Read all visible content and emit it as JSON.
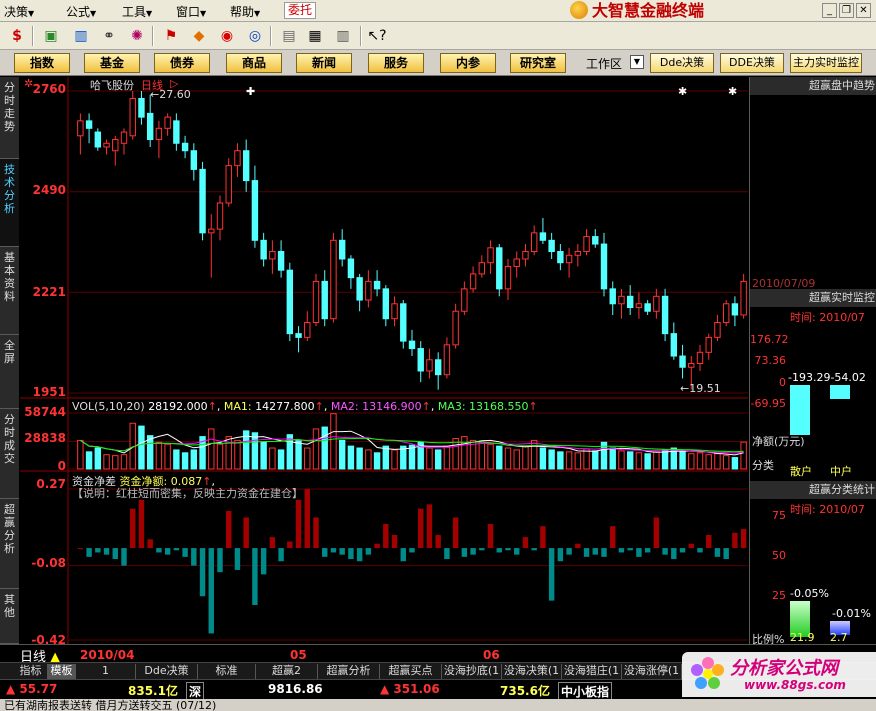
{
  "menu": {
    "items": [
      "决策",
      "公式",
      "工具",
      "窗口",
      "帮助"
    ],
    "entrust": "委托"
  },
  "brand": {
    "title": "大智慧金融终端"
  },
  "funcbar": {
    "buttons": [
      "指数",
      "基金",
      "债券",
      "商品",
      "新闻",
      "服务",
      "内参",
      "研究室"
    ],
    "workarea": "工作区",
    "dde_buttons": [
      "Dde决策",
      "DDE决策",
      "主力实时监控"
    ]
  },
  "left_tabs": [
    "分时走势",
    "技术分析",
    "基本资料",
    "全屏",
    "分时成交",
    "超赢分析",
    "其他"
  ],
  "chart": {
    "stock_name": "哈飞股份",
    "period": "日线",
    "price_axis": [
      "2760",
      "2490",
      "2221",
      "1951"
    ],
    "high_label": "27.60",
    "low_label": "19.51",
    "vol_caption": "VOL(5,10,20)",
    "vol_value": "28192.000",
    "ma1_label": "MA1:",
    "ma1_value": "14277.800",
    "ma2_label": "MA2:",
    "ma2_value": "13146.900",
    "ma3_label": "MA3:",
    "ma3_value": "13168.550",
    "vol_axis": [
      "58744",
      "28838",
      "0"
    ],
    "fund_caption": "资金净差",
    "fund_label": "资金净额:",
    "fund_value": "0.087",
    "fund_note": "【说明：红柱短而密集，反映主力资金在建仓】",
    "fund_axis": [
      "0.27",
      "-0.08",
      "-0.42"
    ],
    "dates": [
      "2010/04",
      "05",
      "06"
    ],
    "date_top_right": "2010/07/09",
    "colors": {
      "up": "#ff3333",
      "down": "#54ffff",
      "fund_up": "#a50000",
      "fund_down": "#008b8b",
      "ma1": "#ffffff",
      "ma2": "#ff00ff",
      "ma3": "#00ff00"
    }
  },
  "chart_data": [
    {
      "type": "candlestick",
      "title": "哈飞股份 日线",
      "ylim": [
        19.51,
        27.6
      ],
      "ticks": [
        27.6,
        24.9,
        22.21,
        19.51
      ],
      "candles": [
        [
          26.4,
          27.0,
          25.9,
          26.8
        ],
        [
          26.8,
          27.0,
          26.2,
          26.6
        ],
        [
          26.5,
          26.6,
          26.0,
          26.1
        ],
        [
          26.1,
          26.3,
          25.9,
          26.2
        ],
        [
          26.0,
          26.4,
          25.6,
          26.3
        ],
        [
          26.2,
          26.6,
          25.9,
          26.5
        ],
        [
          26.4,
          27.6,
          26.3,
          27.4
        ],
        [
          27.4,
          27.6,
          26.7,
          26.9
        ],
        [
          27.0,
          27.5,
          26.1,
          26.3
        ],
        [
          26.3,
          26.8,
          25.8,
          26.6
        ],
        [
          26.6,
          27.0,
          26.4,
          26.9
        ],
        [
          26.8,
          27.0,
          26.0,
          26.2
        ],
        [
          26.2,
          26.4,
          25.8,
          26.0
        ],
        [
          26.0,
          26.2,
          25.2,
          25.5
        ],
        [
          25.5,
          25.7,
          23.6,
          23.8
        ],
        [
          23.8,
          24.3,
          22.6,
          23.9
        ],
        [
          23.9,
          24.8,
          23.6,
          24.6
        ],
        [
          24.6,
          25.8,
          24.5,
          25.6
        ],
        [
          25.6,
          26.2,
          25.3,
          26.0
        ],
        [
          26.0,
          26.3,
          24.9,
          25.2
        ],
        [
          25.2,
          25.6,
          23.4,
          23.6
        ],
        [
          23.6,
          23.8,
          22.9,
          23.1
        ],
        [
          23.1,
          23.6,
          22.7,
          23.3
        ],
        [
          23.3,
          23.6,
          22.6,
          22.8
        ],
        [
          22.8,
          23.0,
          20.9,
          21.1
        ],
        [
          21.1,
          21.3,
          20.6,
          21.0
        ],
        [
          21.0,
          21.7,
          20.9,
          21.4
        ],
        [
          21.4,
          22.7,
          21.3,
          22.5
        ],
        [
          22.5,
          22.8,
          21.3,
          21.5
        ],
        [
          21.5,
          23.8,
          21.4,
          23.6
        ],
        [
          23.6,
          23.9,
          22.9,
          23.1
        ],
        [
          23.1,
          23.2,
          22.3,
          22.6
        ],
        [
          22.6,
          22.7,
          21.7,
          22.0
        ],
        [
          22.0,
          22.8,
          21.8,
          22.5
        ],
        [
          22.5,
          22.8,
          22.1,
          22.3
        ],
        [
          22.3,
          22.4,
          21.3,
          21.5
        ],
        [
          21.5,
          22.1,
          21.3,
          21.9
        ],
        [
          21.9,
          22.0,
          20.7,
          20.9
        ],
        [
          20.9,
          21.2,
          20.5,
          20.7
        ],
        [
          20.7,
          20.9,
          19.8,
          20.1
        ],
        [
          20.1,
          20.7,
          19.9,
          20.4
        ],
        [
          20.4,
          20.6,
          19.6,
          20.0
        ],
        [
          20.0,
          21.0,
          19.9,
          20.8
        ],
        [
          20.8,
          21.9,
          20.7,
          21.7
        ],
        [
          21.7,
          22.5,
          21.6,
          22.3
        ],
        [
          22.3,
          22.9,
          22.2,
          22.7
        ],
        [
          22.7,
          23.2,
          22.6,
          23.0
        ],
        [
          23.0,
          23.6,
          22.7,
          23.4
        ],
        [
          23.4,
          23.5,
          22.1,
          22.3
        ],
        [
          22.3,
          23.1,
          22.0,
          22.9
        ],
        [
          22.9,
          23.3,
          22.6,
          23.1
        ],
        [
          23.1,
          23.5,
          22.9,
          23.3
        ],
        [
          23.3,
          24.0,
          23.2,
          23.8
        ],
        [
          23.8,
          24.2,
          23.5,
          23.6
        ],
        [
          23.6,
          23.8,
          23.1,
          23.3
        ],
        [
          23.3,
          23.5,
          22.8,
          23.0
        ],
        [
          23.0,
          23.4,
          22.6,
          23.2
        ],
        [
          23.2,
          23.5,
          22.9,
          23.3
        ],
        [
          23.3,
          23.9,
          23.2,
          23.7
        ],
        [
          23.7,
          23.9,
          23.4,
          23.5
        ],
        [
          23.5,
          23.8,
          22.1,
          22.3
        ],
        [
          22.3,
          22.5,
          21.6,
          21.9
        ],
        [
          21.9,
          22.3,
          21.5,
          22.1
        ],
        [
          22.1,
          22.4,
          21.6,
          21.8
        ],
        [
          21.8,
          22.2,
          21.5,
          21.9
        ],
        [
          21.9,
          22.0,
          21.6,
          21.7
        ],
        [
          21.7,
          22.3,
          21.5,
          22.1
        ],
        [
          22.1,
          22.3,
          20.9,
          21.1
        ],
        [
          21.1,
          21.4,
          20.4,
          20.5
        ],
        [
          20.5,
          20.8,
          19.9,
          20.2
        ],
        [
          20.2,
          20.5,
          19.6,
          20.3
        ],
        [
          20.3,
          20.8,
          20.1,
          20.6
        ],
        [
          20.6,
          21.1,
          20.4,
          21.0
        ],
        [
          21.0,
          21.6,
          20.9,
          21.4
        ],
        [
          21.4,
          22.0,
          21.3,
          21.9
        ],
        [
          21.9,
          22.1,
          21.3,
          21.6
        ],
        [
          21.6,
          22.7,
          21.5,
          22.5
        ]
      ]
    },
    {
      "type": "bar",
      "title": "VOL(5,10,20)",
      "ylim": [
        0,
        58744
      ],
      "ticks": [
        58744,
        28838,
        0
      ],
      "values": [
        30000,
        18000,
        22000,
        15000,
        14000,
        15000,
        48000,
        45000,
        35000,
        28000,
        26000,
        20000,
        17000,
        20000,
        34000,
        42000,
        26000,
        34000,
        30000,
        40000,
        38000,
        28000,
        22000,
        20000,
        36000,
        30000,
        22000,
        42000,
        44000,
        58000,
        30000,
        24000,
        22000,
        20000,
        17000,
        24000,
        20000,
        24000,
        25000,
        28000,
        22000,
        20000,
        24000,
        32000,
        34000,
        30000,
        28000,
        26000,
        24000,
        22000,
        20000,
        24000,
        30000,
        22000,
        20000,
        18000,
        18000,
        17000,
        21000,
        19000,
        28000,
        22000,
        19000,
        18000,
        17000,
        16000,
        18000,
        20000,
        22000,
        18000,
        16000,
        17000,
        15000,
        16000,
        14000,
        12000,
        28192
      ]
    },
    {
      "type": "bar",
      "title": "资金净差",
      "ylim": [
        -0.42,
        0.27
      ],
      "ticks": [
        0.27,
        -0.08,
        -0.42
      ],
      "values": [
        0.0,
        -0.04,
        -0.02,
        -0.03,
        -0.05,
        -0.08,
        0.18,
        0.22,
        0.04,
        -0.02,
        -0.03,
        -0.01,
        -0.04,
        -0.08,
        -0.22,
        -0.39,
        -0.11,
        0.17,
        -0.1,
        0.14,
        -0.26,
        -0.12,
        0.05,
        -0.06,
        0.03,
        0.22,
        0.27,
        0.14,
        -0.04,
        -0.02,
        -0.03,
        -0.05,
        -0.06,
        -0.03,
        0.02,
        0.11,
        0.06,
        -0.06,
        -0.02,
        0.18,
        0.2,
        0.06,
        -0.05,
        0.14,
        -0.04,
        -0.03,
        -0.01,
        0.11,
        -0.02,
        -0.01,
        -0.03,
        0.05,
        -0.01,
        0.1,
        -0.24,
        -0.06,
        -0.03,
        0.02,
        -0.04,
        -0.03,
        -0.04,
        0.1,
        -0.02,
        -0.01,
        -0.04,
        -0.02,
        0.14,
        -0.03,
        -0.05,
        -0.02,
        0.02,
        -0.02,
        0.06,
        -0.04,
        -0.05,
        0.07,
        0.087
      ]
    }
  ],
  "right_panel": {
    "header1": "超赢盘中趋势",
    "date1": "2010/07/09",
    "header2": "超赢实时监控",
    "time_label": "时间: 2010/07",
    "axis": [
      "176.72",
      "73.36",
      "0",
      "-69.95"
    ],
    "values_text": "-193.29-54.02",
    "net_label": "净额(万元)",
    "class_label": "分类",
    "retail": "散户",
    "mid": "中户",
    "header3": "超赢分类统计",
    "time_label2": "时间: 2010/07",
    "axis2": [
      "75",
      "50",
      "25"
    ],
    "pct1": "-0.05%",
    "pct2": "-0.01%",
    "ratio_label": "比例%",
    "ratio1": "21.9",
    "ratio2": "2.7"
  },
  "period_bar": {
    "period": "日线"
  },
  "tabs": [
    "指标",
    "模板",
    "1",
    "Dde决策",
    "标准",
    "超赢2",
    "超赢分析",
    "超赢买点",
    "没海抄底(1",
    "没海决策(1",
    "没海猎庄(1",
    "没海涨停(1"
  ],
  "index_bar": {
    "sh_change": "55.77",
    "sh_amount": "835.1亿",
    "sh_label": "深",
    "sz_index": "9816.86",
    "sz_change": "351.06",
    "sz_amount": "735.6亿",
    "sme_label": "中小板指"
  },
  "status_text": "已有湖南报表送转 借月方送转交五 (07/12)",
  "watermark": {
    "title": "分析家公式网",
    "url": "www.88gs.com"
  }
}
